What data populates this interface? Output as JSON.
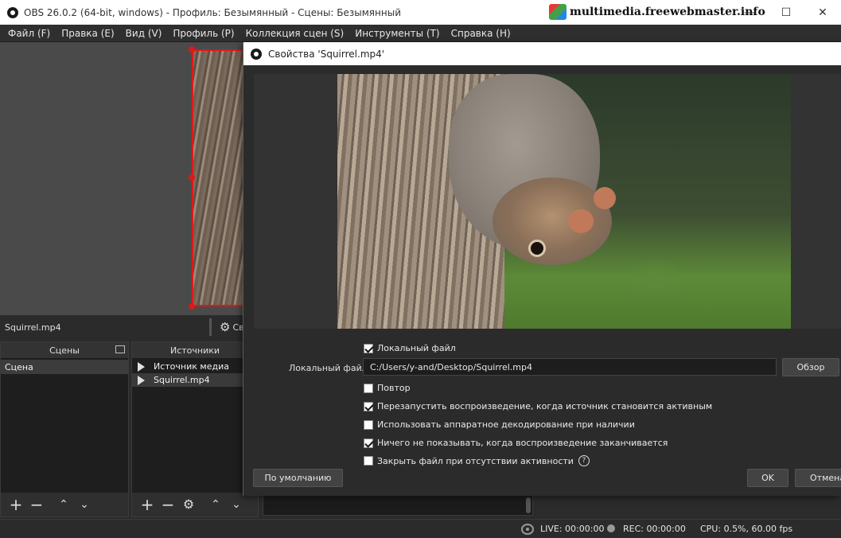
{
  "window": {
    "title": "OBS 26.0.2 (64-bit, windows) - Профиль: Безымянный - Сцены: Безымянный",
    "watermark": "multimedia.freewebmaster.info"
  },
  "menu": [
    "Файл (F)",
    "Правка (E)",
    "Вид (V)",
    "Профиль (P)",
    "Коллекция сцен (S)",
    "Инструменты (T)",
    "Справка (H)"
  ],
  "source_bar": {
    "selected_source": "Squirrel.mp4",
    "properties_label": "Св"
  },
  "scenes": {
    "header": "Сцены",
    "items": [
      "Сцена"
    ]
  },
  "sources": {
    "header": "Источники",
    "items": [
      "Источник медиа",
      "Squirrel.mp4"
    ]
  },
  "status": {
    "live": "LIVE: 00:00:00",
    "rec": "REC: 00:00:00",
    "cpu": "CPU: 0.5%, 60.00 fps"
  },
  "dialog": {
    "title": "Свойства 'Squirrel.mp4'",
    "local_file_checkbox": "Локальный файл",
    "local_file_label": "Локальный файл",
    "local_file_path": "C:/Users/y-and/Desktop/Squirrel.mp4",
    "browse_button": "Обзор",
    "options": [
      {
        "label": "Повтор",
        "checked": false
      },
      {
        "label": "Перезапустить воспроизведение, когда источник становится активным",
        "checked": true
      },
      {
        "label": "Использовать аппаратное декодирование при наличии",
        "checked": false
      },
      {
        "label": "Ничего не показывать, когда воспроизведение заканчивается",
        "checked": true
      },
      {
        "label": "Закрыть файл при отсутствии активности",
        "checked": false
      }
    ],
    "defaults_button": "По умолчанию",
    "ok_button": "OK",
    "cancel_button": "Отмена"
  },
  "colors": {
    "selection_red": "#e01818",
    "panel_bg": "#2b2b2b"
  }
}
